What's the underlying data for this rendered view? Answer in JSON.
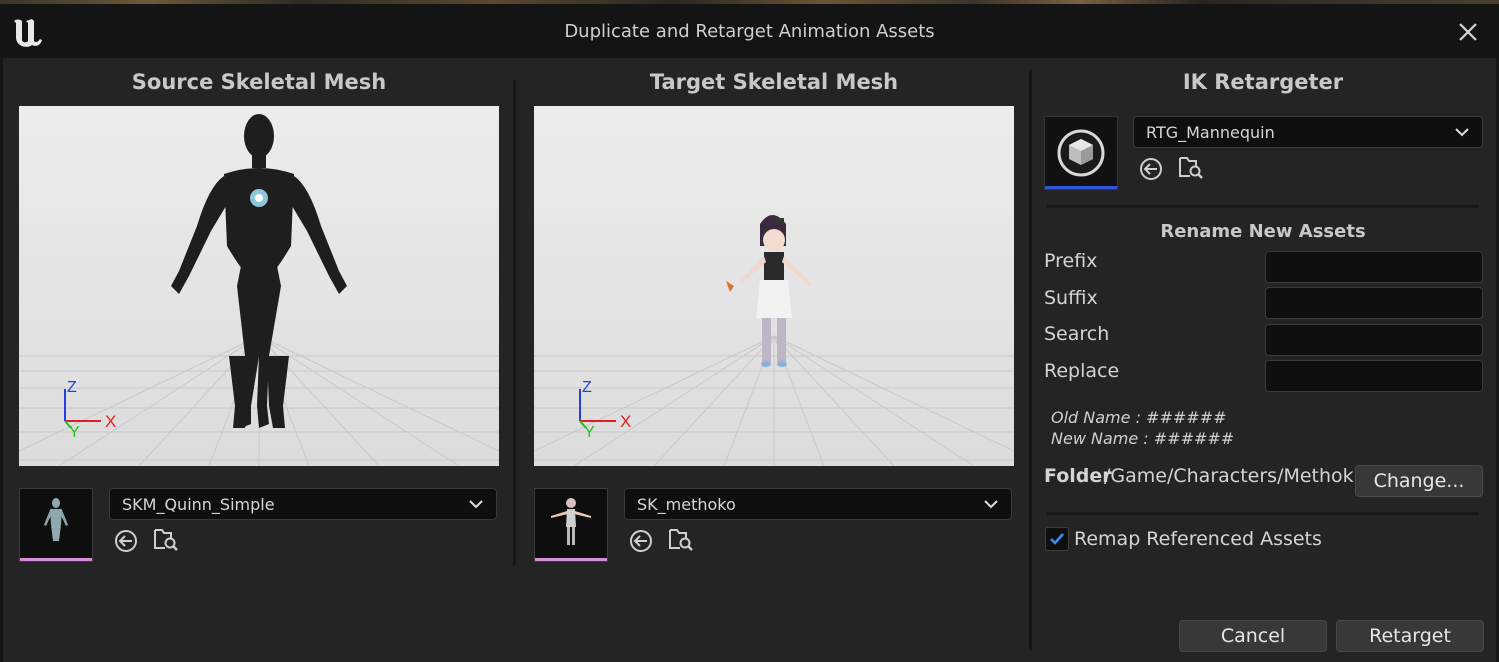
{
  "window": {
    "title": "Duplicate and Retarget Animation Assets",
    "close_icon": "close-icon",
    "logo_icon": "unreal-logo-icon"
  },
  "source": {
    "title": "Source Skeletal Mesh",
    "mesh_name": "SKM_Quinn_Simple",
    "axis": {
      "z": "Z",
      "y": "Y",
      "x": "X"
    }
  },
  "target": {
    "title": "Target Skeletal Mesh",
    "mesh_name": "SK_methoko",
    "axis": {
      "z": "Z",
      "y": "Y",
      "x": "X"
    }
  },
  "retargeter": {
    "title": "IK Retargeter",
    "asset_name": "RTG_Mannequin",
    "rename_title": "Rename New Assets",
    "prefix_label": "Prefix",
    "suffix_label": "Suffix",
    "search_label": "Search",
    "replace_label": "Replace",
    "prefix_value": "",
    "suffix_value": "",
    "search_value": "",
    "replace_value": "",
    "old_name": "Old Name : ######",
    "new_name": "New Name : ######",
    "folder_label": "Folder",
    "folder_path": "/Game/Characters/Methoko",
    "change_button": "Change...",
    "remap_label": "Remap Referenced Assets",
    "remap_checked": true
  },
  "footer": {
    "cancel": "Cancel",
    "retarget": "Retarget"
  },
  "colors": {
    "accent_blue": "#2f55e0",
    "thumb_pink": "#d58fd8",
    "axis_x": "#e02020",
    "axis_y": "#20c020",
    "axis_z": "#2040e0"
  }
}
